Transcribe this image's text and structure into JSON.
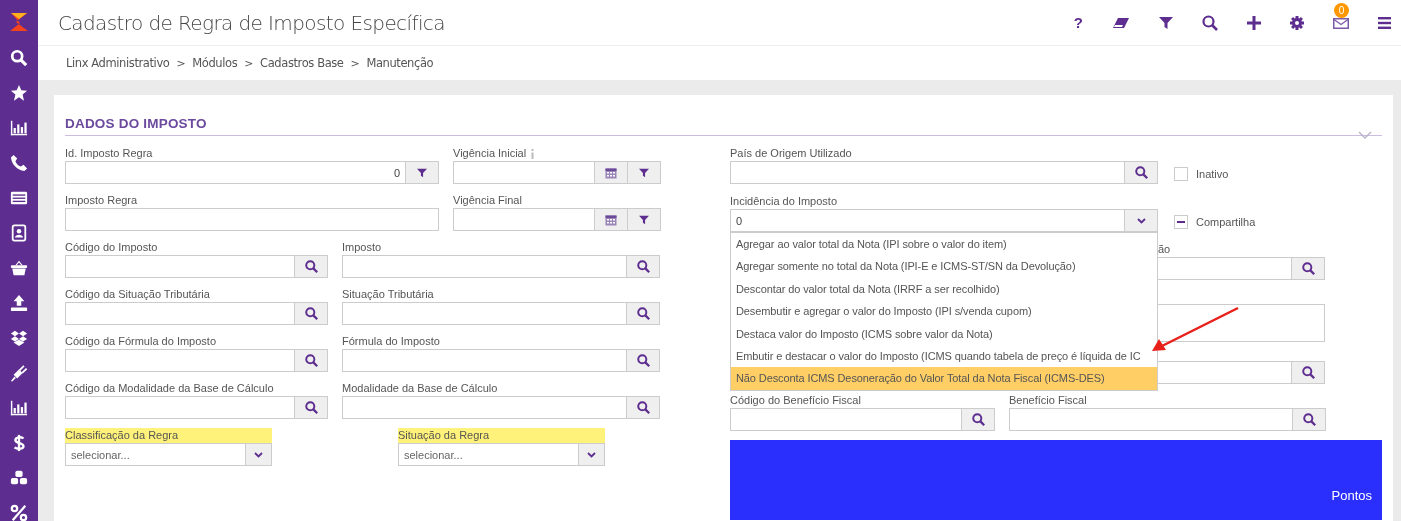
{
  "app": {
    "title": "Cadastro de Regra de Imposto Específica",
    "help_icon": "?",
    "notification_count": "0"
  },
  "breadcrumb": {
    "separator": ">",
    "items": [
      "Linx Administrativo",
      "Módulos",
      "Cadastros Base",
      "Manutenção"
    ]
  },
  "section": {
    "title": "DADOS DO IMPOSTO"
  },
  "left_rows": [
    [
      {
        "kind": "filter",
        "label": "Id. Imposto Regra",
        "value": "0"
      },
      {
        "kind": "date",
        "label": "Vigência Inicial",
        "info": true
      }
    ],
    [
      {
        "kind": "text",
        "label": "Imposto Regra"
      },
      {
        "kind": "date",
        "label": "Vigência Final"
      }
    ],
    [
      {
        "kind": "code",
        "label": "Código do Imposto"
      },
      {
        "kind": "lookup",
        "label": "Imposto"
      }
    ],
    [
      {
        "kind": "code",
        "label": "Código da Situação Tributária"
      },
      {
        "kind": "lookup",
        "label": "Situação Tributária"
      }
    ],
    [
      {
        "kind": "code",
        "label": "Código da Fórmula do Imposto"
      },
      {
        "kind": "lookup",
        "label": "Fórmula do Imposto"
      }
    ],
    [
      {
        "kind": "code",
        "label": "Código da Modalidade da Base de Cálculo"
      },
      {
        "kind": "lookup",
        "label": "Modalidade da Base de Cálculo"
      }
    ],
    [
      {
        "kind": "select",
        "label": "Classificação da Regra",
        "highlighted": true,
        "placeholder": "selecionar..."
      },
      {
        "kind": "select",
        "label": "Situação da Regra",
        "highlighted": true,
        "placeholder": "selecionar..."
      }
    ]
  ],
  "right": {
    "country": {
      "label": "País de Origem Utilizado"
    },
    "inactive": {
      "label": "Inativo",
      "checked": false
    },
    "incidence": {
      "label": "Incidência do Imposto",
      "value": "0",
      "expanded": true,
      "options": [
        {
          "label": "Agregar ao valor total da Nota (IPI sobre o valor do item)",
          "selected": false
        },
        {
          "label": "Agregar somente no total da Nota (IPI-E e ICMS-ST/SN da Devolução)",
          "selected": false
        },
        {
          "label": "Descontar do valor total da Nota (IRRF a ser recolhido)",
          "selected": false
        },
        {
          "label": "Desembutir e agregar o valor do Imposto (IPI s/venda cupom)",
          "selected": false
        },
        {
          "label": "Destaca valor do Imposto (ICMS sobre valor da Nota)",
          "selected": false
        },
        {
          "label": "Embutir e destacar o valor do Imposto (ICMS quando tabela de preço é líquida de IC",
          "selected": false
        },
        {
          "label": "Não Desconta ICMS Desoneração do Valor Total da Nota Fiscal (ICMS-DES)",
          "selected": true
        }
      ]
    },
    "shared": {
      "label": "Compartilha",
      "indeterminate": true
    },
    "covered_fields": [
      {
        "kind": "lookup",
        "label": "ão"
      },
      {
        "kind": "textarea"
      },
      {
        "kind": "lookup"
      }
    ],
    "benefit": [
      {
        "kind": "code",
        "label": "Código do Benefício Fiscal"
      },
      {
        "kind": "lookup",
        "label": "Benefício Fiscal"
      }
    ],
    "panel": {
      "label": "Pontos"
    }
  }
}
